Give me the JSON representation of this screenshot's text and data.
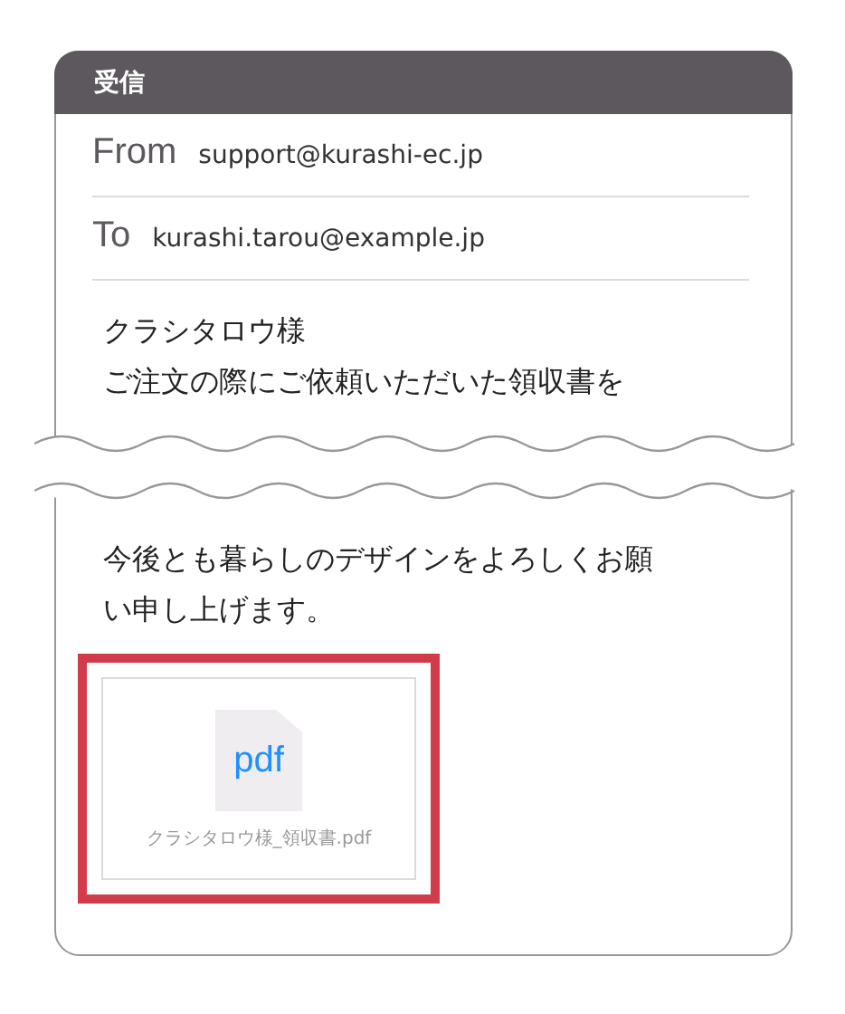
{
  "header": {
    "title": "受信"
  },
  "fields": [
    {
      "label": "From",
      "value": "support@kurashi-ec.jp"
    },
    {
      "label": "To",
      "value": "kurashi.tarou@example.jp"
    }
  ],
  "body_before_break": [
    "クラシタロウ様",
    "ご注文の際にご依頼いただいた領収書を"
  ],
  "body_after_break": [
    "今後とも暮らしのデザインをよろしくお願",
    "い申し上げます。"
  ],
  "attachment": {
    "highlighted": true,
    "file_type": "pdf",
    "filename": "クラシタロウ様_領収書.pdf"
  }
}
